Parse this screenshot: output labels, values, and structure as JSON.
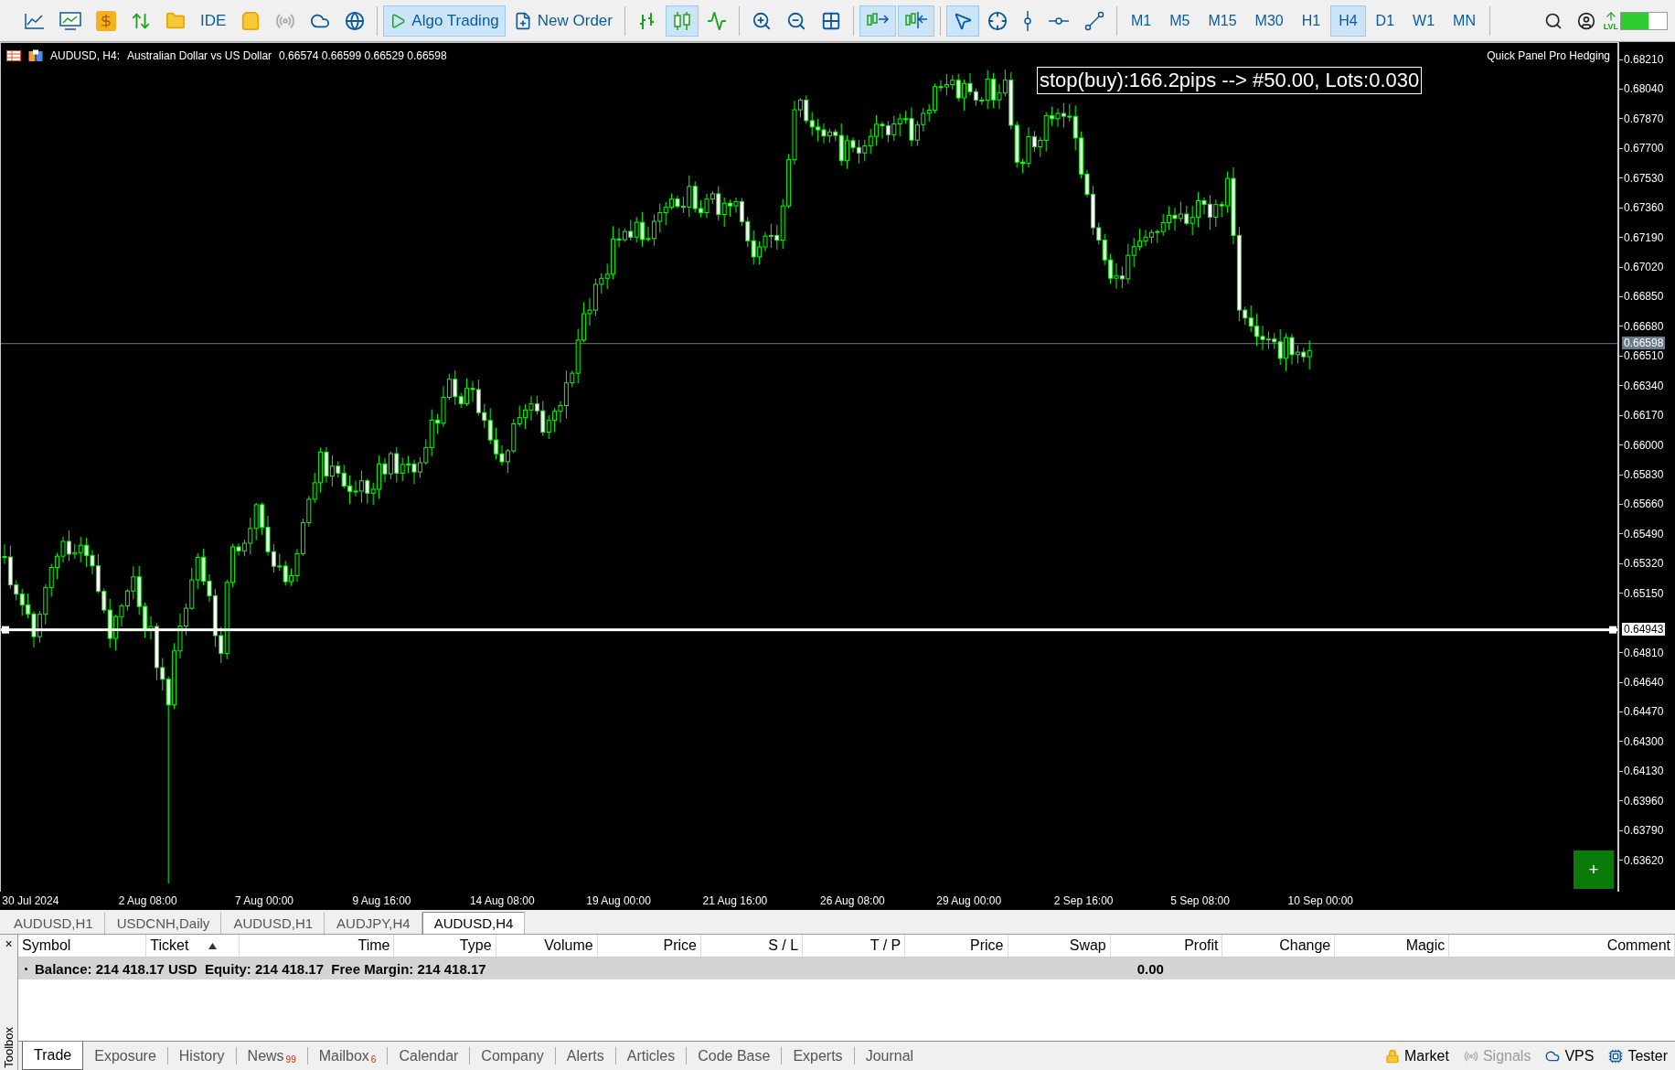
{
  "toolbar": {
    "items": [
      {
        "kind": "chart-menu",
        "selected": false
      },
      {
        "kind": "indicators-menu",
        "selected": false
      },
      {
        "kind": "market",
        "selected": false
      },
      {
        "kind": "trade",
        "selected": false
      },
      {
        "kind": "navigator",
        "selected": false
      },
      {
        "kind": "ide",
        "label": "IDE",
        "selected": false
      },
      {
        "kind": "shop",
        "selected": false
      },
      {
        "kind": "signal",
        "selected": false,
        "disabled": true
      },
      {
        "kind": "cloud",
        "selected": false
      },
      {
        "kind": "network",
        "selected": false
      },
      {
        "kind": "separator"
      },
      {
        "kind": "algo",
        "label": "Algo Trading",
        "selected": true
      },
      {
        "kind": "new-order",
        "label": "New Order",
        "selected": false
      },
      {
        "kind": "separator"
      },
      {
        "kind": "bars",
        "selected": false
      },
      {
        "kind": "candles",
        "selected": true
      },
      {
        "kind": "line",
        "selected": false
      },
      {
        "kind": "separator"
      },
      {
        "kind": "zoom-in",
        "selected": false
      },
      {
        "kind": "zoom-out",
        "selected": false
      },
      {
        "kind": "grid",
        "selected": false
      },
      {
        "kind": "separator"
      },
      {
        "kind": "autoscroll",
        "selected": true
      },
      {
        "kind": "shift",
        "selected": true
      },
      {
        "kind": "separator"
      },
      {
        "kind": "cursor",
        "selected": true
      },
      {
        "kind": "crosshair",
        "selected": false
      },
      {
        "kind": "vline",
        "selected": false
      },
      {
        "kind": "hline",
        "selected": false
      },
      {
        "kind": "trendline",
        "selected": false
      },
      {
        "kind": "separator"
      },
      {
        "kind": "timeframe",
        "label": "M1",
        "selected": false
      },
      {
        "kind": "timeframe",
        "label": "M5",
        "selected": false
      },
      {
        "kind": "timeframe",
        "label": "M15",
        "selected": false
      },
      {
        "kind": "timeframe",
        "label": "M30",
        "selected": false
      },
      {
        "kind": "timeframe",
        "label": "H1",
        "selected": false
      },
      {
        "kind": "timeframe",
        "label": "H4",
        "selected": true
      },
      {
        "kind": "timeframe",
        "label": "D1",
        "selected": false
      },
      {
        "kind": "timeframe",
        "label": "W1",
        "selected": false
      },
      {
        "kind": "timeframe",
        "label": "MN",
        "selected": false
      },
      {
        "kind": "separator"
      },
      {
        "kind": "search",
        "selected": false
      },
      {
        "kind": "account",
        "selected": false
      },
      {
        "kind": "level",
        "label": "LVL"
      },
      {
        "kind": "meter"
      }
    ]
  },
  "chart": {
    "header": {
      "symbol": "AUDUSD, H4:",
      "description": "Australian Dollar vs US Dollar",
      "ohlc": "0.66574 0.66599 0.66529 0.66598"
    },
    "panel_label": "Quick Panel Pro Hedging",
    "order_label": "stop(buy):166.2pips --> #50.00, Lots:0.030",
    "price_ticks_upper": [
      "0.68210",
      "0.68040",
      "0.67870",
      "0.67700",
      "0.67530",
      "0.67360",
      "0.67190",
      "0.67020",
      "0.66850",
      "0.66680",
      "0.66510",
      "0.66340",
      "0.66170",
      "0.66000",
      "0.65830",
      "0.65660",
      "0.65490",
      "0.65320",
      "0.65150"
    ],
    "price_ticks_lower": [
      "0.64810",
      "0.64640",
      "0.64470",
      "0.64300",
      "0.64130",
      "0.63960",
      "0.63790",
      "0.63620"
    ],
    "bid_label": "0.66598",
    "line_label": "0.64943",
    "time_ticks": [
      "30 Jul 2024",
      "2 Aug 08:00",
      "7 Aug 00:00",
      "9 Aug 16:00",
      "14 Aug 08:00",
      "19 Aug 00:00",
      "21 Aug 16:00",
      "26 Aug 08:00",
      "29 Aug 00:00",
      "2 Sep 16:00",
      "5 Sep 08:00",
      "10 Sep 00:00"
    ],
    "add_button": "+"
  },
  "chart_tabs": [
    {
      "label": "AUDUSD,H1",
      "selected": false
    },
    {
      "label": "USDCNH,Daily",
      "selected": false
    },
    {
      "label": "AUDUSD,H1",
      "selected": false
    },
    {
      "label": "AUDJPY,H4",
      "selected": false
    },
    {
      "label": "AUDUSD,H4",
      "selected": true
    }
  ],
  "toolbox": {
    "close": "×",
    "label": "Toolbox"
  },
  "trade_table": {
    "columns": [
      {
        "label": "Symbol",
        "sorted": false
      },
      {
        "label": "Ticket",
        "sorted": true
      },
      {
        "label": "Time",
        "sorted": false
      },
      {
        "label": "Type",
        "sorted": false
      },
      {
        "label": "Volume",
        "sorted": false
      },
      {
        "label": "Price",
        "sorted": false
      },
      {
        "label": "S / L",
        "sorted": false
      },
      {
        "label": "T / P",
        "sorted": false
      },
      {
        "label": "Price",
        "sorted": false
      },
      {
        "label": "Swap",
        "sorted": false
      },
      {
        "label": "Profit",
        "sorted": false
      },
      {
        "label": "Change",
        "sorted": false
      },
      {
        "label": "Magic",
        "sorted": false
      },
      {
        "label": "Comment",
        "sorted": false
      }
    ],
    "summary": {
      "text": "Balance: 214 418.17 USD  Equity: 214 418.17  Free Margin: 214 418.17",
      "profit": "0.00"
    }
  },
  "bottom_tabs": [
    {
      "label": "Trade",
      "selected": true
    },
    {
      "label": "Exposure",
      "selected": false
    },
    {
      "label": "History",
      "selected": false
    },
    {
      "label": "News",
      "badge": "99",
      "selected": false
    },
    {
      "label": "Mailbox",
      "badge": "6",
      "selected": false
    },
    {
      "label": "Calendar",
      "selected": false
    },
    {
      "label": "Company",
      "selected": false
    },
    {
      "label": "Alerts",
      "selected": false
    },
    {
      "label": "Articles",
      "selected": false
    },
    {
      "label": "Code Base",
      "selected": false
    },
    {
      "label": "Experts",
      "selected": false
    },
    {
      "label": "Journal",
      "selected": false
    }
  ],
  "status_items": [
    {
      "kind": "market",
      "label": "Market",
      "disabled": false
    },
    {
      "kind": "signals",
      "label": "Signals",
      "disabled": true
    },
    {
      "kind": "vps",
      "label": "VPS",
      "disabled": false
    },
    {
      "kind": "tester",
      "label": "Tester",
      "disabled": false
    }
  ]
}
